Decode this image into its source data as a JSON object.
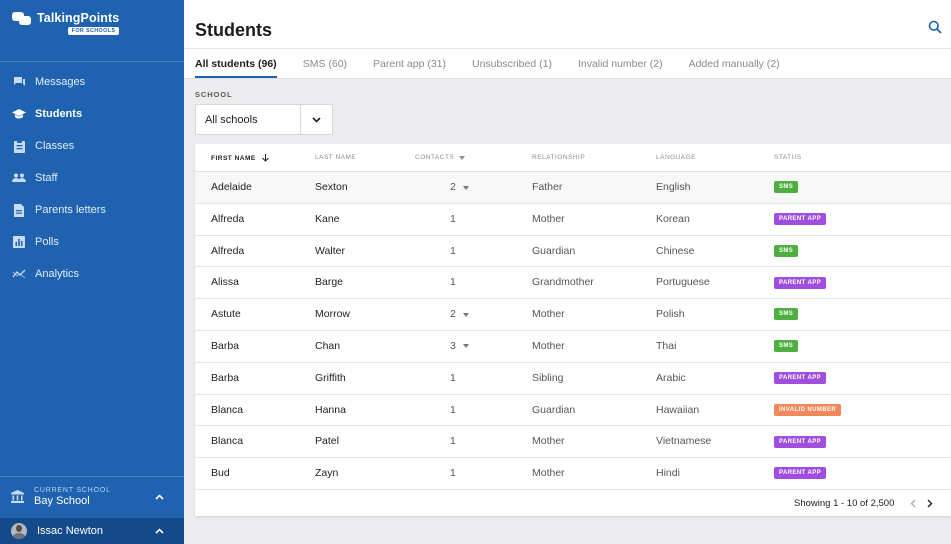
{
  "app": {
    "brand_name": "TalkingPoints",
    "brand_badge": "FOR SCHOOLS"
  },
  "sidebar": {
    "items": [
      {
        "label": "Messages",
        "icon": "chat-icon",
        "active": false
      },
      {
        "label": "Students",
        "icon": "graduation-cap-icon",
        "active": true
      },
      {
        "label": "Classes",
        "icon": "clipboard-icon",
        "active": false
      },
      {
        "label": "Staff",
        "icon": "people-icon",
        "active": false
      },
      {
        "label": "Parents letters",
        "icon": "document-icon",
        "active": false
      },
      {
        "label": "Polls",
        "icon": "bar-chart-icon",
        "active": false
      },
      {
        "label": "Analytics",
        "icon": "trend-line-icon",
        "active": false
      }
    ],
    "current_school_label": "CURRENT SCHOOL",
    "current_school": "Bay School",
    "user_name": "Issac Newton"
  },
  "header": {
    "title": "Students",
    "tabs": [
      {
        "label": "All students (96)",
        "active": true
      },
      {
        "label": "SMS (60)",
        "active": false
      },
      {
        "label": "Parent app (31)",
        "active": false
      },
      {
        "label": "Unsubscribed (1)",
        "active": false
      },
      {
        "label": "Invalid number (2)",
        "active": false
      },
      {
        "label": "Added manually (2)",
        "active": false
      }
    ]
  },
  "filter": {
    "label": "SCHOOL",
    "selected": "All schools"
  },
  "table": {
    "columns": {
      "first_name": "FIRST NAME",
      "last_name": "LAST NAME",
      "contacts": "CONTACTS",
      "relationship": "RELATIONSHIP",
      "language": "LANGUAGE",
      "status": "STATUS"
    },
    "rows": [
      {
        "first": "Adelaide",
        "last": "Sexton",
        "contacts": "2",
        "expandable": true,
        "relationship": "Father",
        "language": "English",
        "status": "SMS"
      },
      {
        "first": "Alfreda",
        "last": "Kane",
        "contacts": "1",
        "expandable": false,
        "relationship": "Mother",
        "language": "Korean",
        "status": "PARENT APP"
      },
      {
        "first": "Alfreda",
        "last": "Walter",
        "contacts": "1",
        "expandable": false,
        "relationship": "Guardian",
        "language": "Chinese",
        "status": "SMS"
      },
      {
        "first": "Alissa",
        "last": "Barge",
        "contacts": "1",
        "expandable": false,
        "relationship": "Grandmother",
        "language": "Portuguese",
        "status": "PARENT APP"
      },
      {
        "first": "Astute",
        "last": "Morrow",
        "contacts": "2",
        "expandable": true,
        "relationship": "Mother",
        "language": "Polish",
        "status": "SMS"
      },
      {
        "first": "Barba",
        "last": "Chan",
        "contacts": "3",
        "expandable": true,
        "relationship": "Mother",
        "language": "Thai",
        "status": "SMS"
      },
      {
        "first": "Barba",
        "last": "Griffith",
        "contacts": "1",
        "expandable": false,
        "relationship": "Sibling",
        "language": "Arabic",
        "status": "PARENT APP"
      },
      {
        "first": "Blanca",
        "last": "Hanna",
        "contacts": "1",
        "expandable": false,
        "relationship": "Guardian",
        "language": "Hawaiian",
        "status": "INVALID NUMBER"
      },
      {
        "first": "Blanca",
        "last": "Patel",
        "contacts": "1",
        "expandable": false,
        "relationship": "Mother",
        "language": "Vietnamese",
        "status": "PARENT APP"
      },
      {
        "first": "Bud",
        "last": "Zayn",
        "contacts": "1",
        "expandable": false,
        "relationship": "Mother",
        "language": "Hindi",
        "status": "PARENT APP"
      }
    ],
    "pagination": "Showing 1 - 10 of 2,500"
  },
  "colors": {
    "sidebar_bg": "#1f63b0",
    "status_sms": "#4caf3e",
    "status_parent_app": "#a04ee0",
    "status_invalid_number": "#f2875a"
  }
}
